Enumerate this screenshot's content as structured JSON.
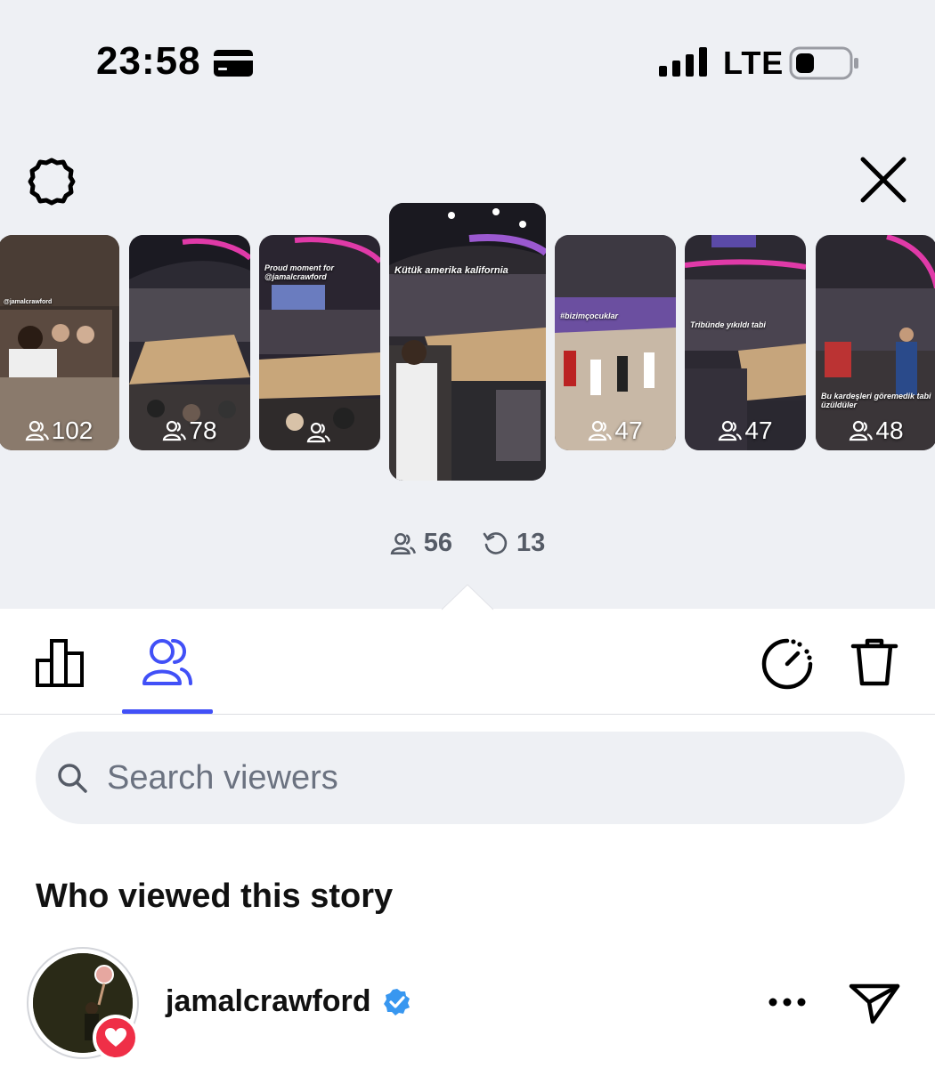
{
  "status_bar": {
    "time": "23:58",
    "network": "LTE"
  },
  "stories": [
    {
      "views": "102",
      "caption": "@jamalcrawford",
      "active": false
    },
    {
      "views": "78",
      "caption": "",
      "active": false
    },
    {
      "views": "",
      "caption": "Proud moment for @jamalcrawford",
      "active": false
    },
    {
      "views": "",
      "caption": "Kütük amerika kalifornia",
      "active": true
    },
    {
      "views": "47",
      "caption": "#bizimçocuklar",
      "active": false
    },
    {
      "views": "47",
      "caption": "Tribünde yıkıldı tabi",
      "active": false
    },
    {
      "views": "48",
      "caption": "Bu kardeşleri göremedik tabi üzüldüler",
      "active": false
    }
  ],
  "selected_story": {
    "viewers": "56",
    "replays": "13"
  },
  "search": {
    "placeholder": "Search viewers",
    "value": ""
  },
  "section_title": "Who viewed this story",
  "viewers": [
    {
      "username": "jamalcrawford",
      "verified": true,
      "reaction": "heart"
    }
  ],
  "colors": {
    "accent": "#4150f7",
    "top_background": "#eef0f4",
    "verified": "#3897f0",
    "heart_badge": "#ef2f47"
  },
  "icons": [
    "card-icon",
    "signal-icon",
    "battery-icon",
    "gear-icon",
    "close-icon",
    "viewers-icon",
    "replay-icon",
    "insights-icon",
    "timer-icon",
    "trash-icon",
    "search-icon",
    "verified-icon",
    "heart-icon",
    "more-icon",
    "send-icon"
  ]
}
